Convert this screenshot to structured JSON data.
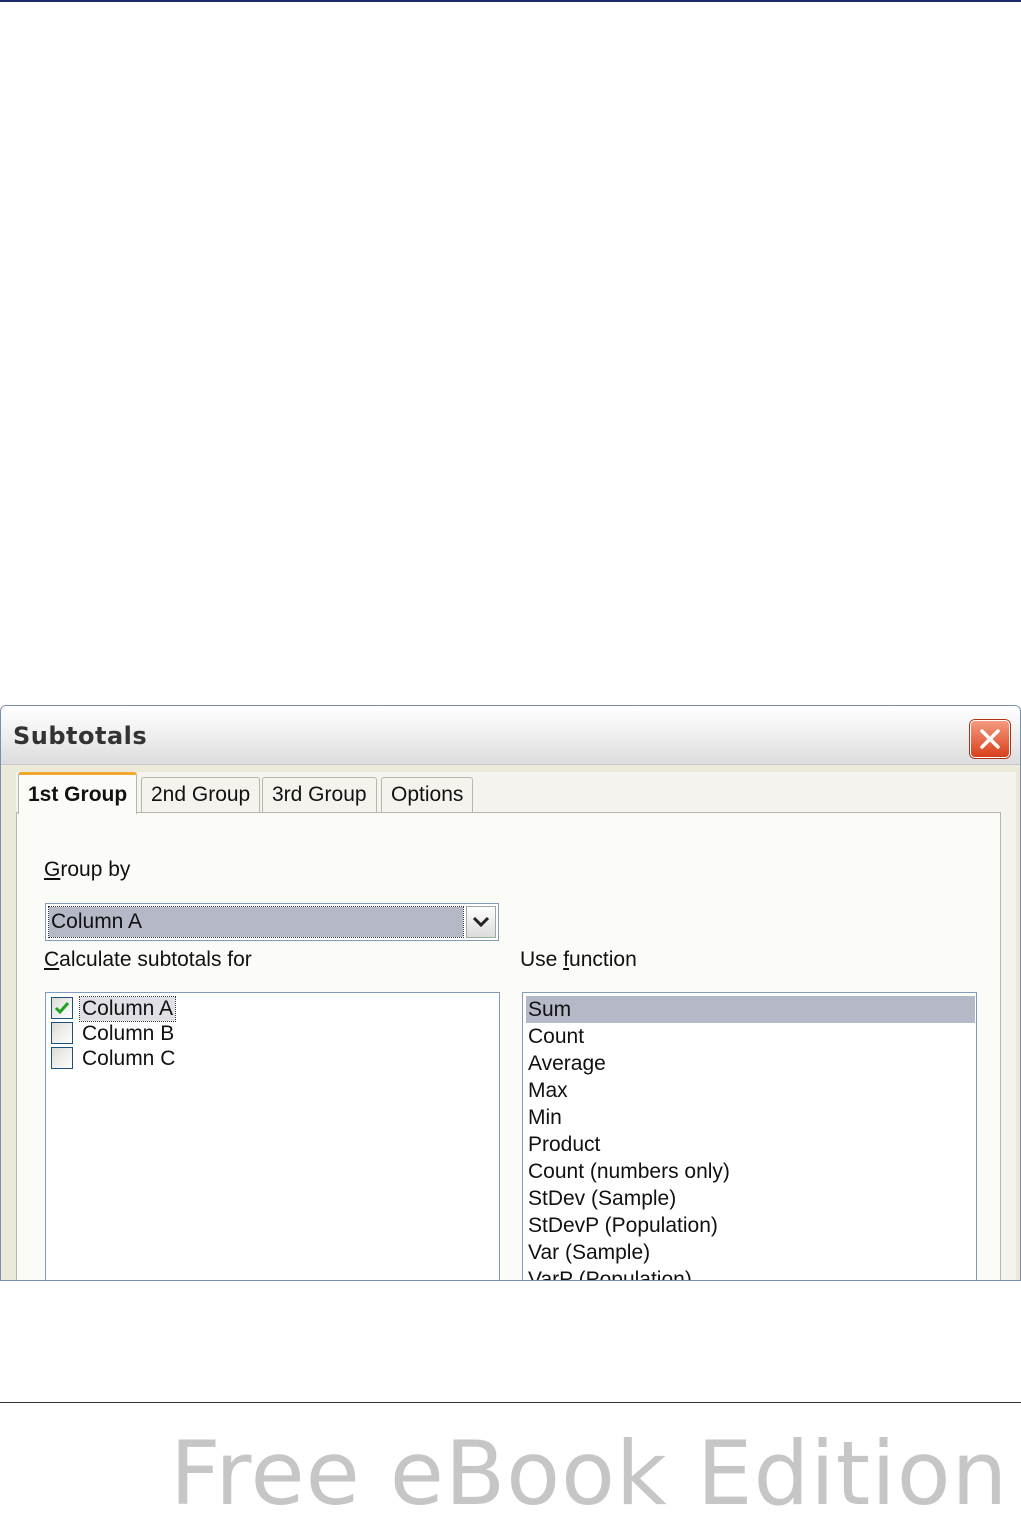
{
  "dialog": {
    "title": "Subtotals",
    "tabs": [
      {
        "label": "1st Group",
        "active": true
      },
      {
        "label": "2nd Group",
        "active": false
      },
      {
        "label": "3rd Group",
        "active": false
      },
      {
        "label": "Options",
        "active": false
      }
    ],
    "group_by": {
      "label_first": "G",
      "label_rest": "roup by",
      "value": "Column A"
    },
    "calculate": {
      "label_first": "C",
      "label_rest": "alculate subtotals for",
      "items": [
        {
          "label": "Column A",
          "checked": true
        },
        {
          "label": "Column B",
          "checked": false
        },
        {
          "label": "Column C",
          "checked": false
        }
      ]
    },
    "use_function": {
      "label_pre": "Use ",
      "label_accel": "f",
      "label_post": "unction",
      "items": [
        {
          "label": "Sum",
          "selected": true
        },
        {
          "label": "Count"
        },
        {
          "label": "Average"
        },
        {
          "label": "Max"
        },
        {
          "label": "Min"
        },
        {
          "label": "Product"
        },
        {
          "label": "Count (numbers only)"
        },
        {
          "label": "StDev (Sample)"
        },
        {
          "label": "StDevP (Population)"
        },
        {
          "label": "Var (Sample)"
        },
        {
          "label": "VarP (Population)"
        }
      ]
    }
  },
  "footer": {
    "watermark": "Free eBook Edition"
  },
  "colors": {
    "selection": "#b5b8c6",
    "active_tab_accent": "#f0a830",
    "close_button": "#d8401c",
    "check_mark": "#21a121"
  }
}
